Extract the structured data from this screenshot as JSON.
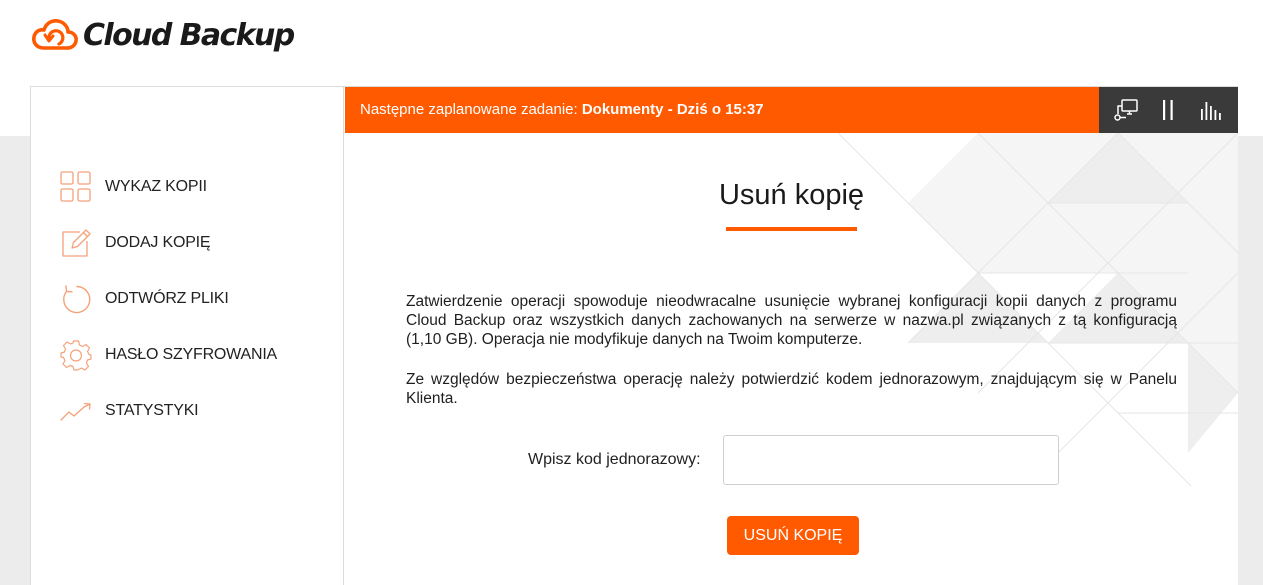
{
  "app": {
    "logo_text": "Cloud Backup",
    "brand_color": "#ff5a00"
  },
  "sidebar": {
    "items": [
      {
        "label": "WYKAZ KOPII",
        "icon": "grid-icon"
      },
      {
        "label": "DODAJ KOPIĘ",
        "icon": "edit-icon"
      },
      {
        "label": "ODTWÓRZ PLIKI",
        "icon": "restore-icon"
      },
      {
        "label": "HASŁO SZYFROWANIA",
        "icon": "gear-icon"
      },
      {
        "label": "STATYSTYKI",
        "icon": "chart-line-icon"
      }
    ]
  },
  "topbar": {
    "prefix": "Następne zaplanowane zadanie: ",
    "task": "Dokumenty - Dziś o 15:37",
    "buttons": [
      "computer-network-icon",
      "pause-icon",
      "bar-chart-icon"
    ]
  },
  "main": {
    "title": "Usuń kopię",
    "paragraph1": "Zatwierdzenie operacji spowoduje nieodwracalne usunięcie wybranej konfiguracji kopii danych z programu Cloud Backup oraz wszystkich danych zachowanych na serwerze w nazwa.pl związanych z tą konfiguracją (1,10 GB). Operacja nie modyfikuje danych na Twoim komputerze.",
    "paragraph2": "Ze względów bezpieczeństwa  operację należy potwierdzić  kodem jednorazowym, znajdującym się w Panelu Klienta.",
    "code_label": "Wpisz kod jednorazowy:",
    "code_value": "",
    "code_placeholder": "",
    "delete_button": "USUŃ KOPIĘ"
  }
}
